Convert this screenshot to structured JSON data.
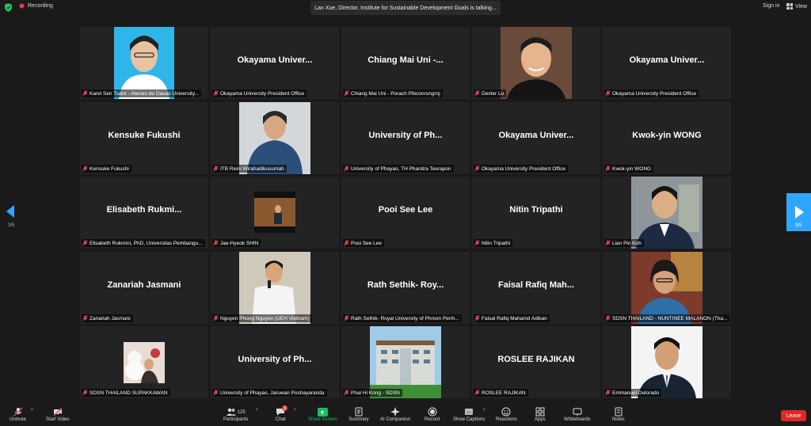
{
  "topbar": {
    "recording_label": "Recording",
    "speaker_banner": "Lan Xue, Director, Institute for Sustainable Development Goals is talking...",
    "signin_label": "Sign in",
    "view_label": "View"
  },
  "pagination": {
    "left": "3/5",
    "right": "3/5"
  },
  "tiles": [
    {
      "name": "",
      "label": "Karel Sen Tudor - Ateneo de Davao University..."
    },
    {
      "name": "Okayama Univer...",
      "label": "Okayama University President Office"
    },
    {
      "name": "Chiang Mai Uni -...",
      "label": "Chiang Mai Uni - Porach Pibconrungroj"
    },
    {
      "name": "",
      "label": "Dexter Lo"
    },
    {
      "name": "Okayama Univer...",
      "label": "Okayama University President Office"
    },
    {
      "name": "Kensuke Fukushi",
      "label": "Kensuke Fukushi"
    },
    {
      "name": "",
      "label": "ITB Reini Wirahadikusumah"
    },
    {
      "name": "University of Ph...",
      "label": "University of Phayao, TH Phanitra Teerapon"
    },
    {
      "name": "Okayama Univer...",
      "label": "Okayama University President Office"
    },
    {
      "name": "Kwok-yin WONG",
      "label": "Kwok-yin WONG"
    },
    {
      "name": "Elisabeth Rukmi...",
      "label": "Elisabeth Rukmini, PhD, Universitas Pembangu..."
    },
    {
      "name": "",
      "label": "Jae-Hyeok SHIN"
    },
    {
      "name": "Pooi See Lee",
      "label": "Pooi See Lee"
    },
    {
      "name": "Nitin Tripathi",
      "label": "Nitin Tripathi"
    },
    {
      "name": "",
      "label": "Lian Pin Koh"
    },
    {
      "name": "Zanariah Jasmani",
      "label": "Zanariah Jasmani"
    },
    {
      "name": "",
      "label": "Nguyen Phong Nguyen (UEH Vietnam)"
    },
    {
      "name": "Rath Sethik- Roy...",
      "label": "Rath Sethik- Royal University of Phnom Penh..."
    },
    {
      "name": "Faisal Rafiq Mah...",
      "label": "Faisal Rafiq Mahamd Adikan"
    },
    {
      "name": "",
      "label": "SDSN THAILAND - NUNTINEE MALANON (Tha..."
    },
    {
      "name": "",
      "label": "SDSN THAILAND SUPAKKAWAN"
    },
    {
      "name": "University of Ph...",
      "label": "University of Phayao, Jaruwan Poshayaranda"
    },
    {
      "name": "",
      "label": "Phai Hi Kong - SDSN"
    },
    {
      "name": "ROSLEE RAJIKAN",
      "label": "ROSLEE RAJIKAN"
    },
    {
      "name": "",
      "label": "Emmanuel Delorado"
    }
  ],
  "toolbar": {
    "unmute": "Unmute",
    "start_video": "Start Video",
    "participants": "Participants",
    "participants_count": "125",
    "chat": "Chat",
    "chat_badge": "2",
    "share_screen": "Share Screen",
    "summary": "Summary",
    "ai_companion": "AI Companion",
    "record": "Record",
    "show_captions": "Show Captions",
    "reactions": "Reactions",
    "apps": "Apps",
    "whiteboards": "Whiteboards",
    "notes": "Notes",
    "leave": "Leave"
  },
  "colors": {
    "background": "#1a1a1a",
    "tile": "#232323",
    "share_green": "#14c15f",
    "leave_red": "#e02828",
    "nav_blue": "#2ea6ff",
    "muted_red": "#e5484d"
  }
}
